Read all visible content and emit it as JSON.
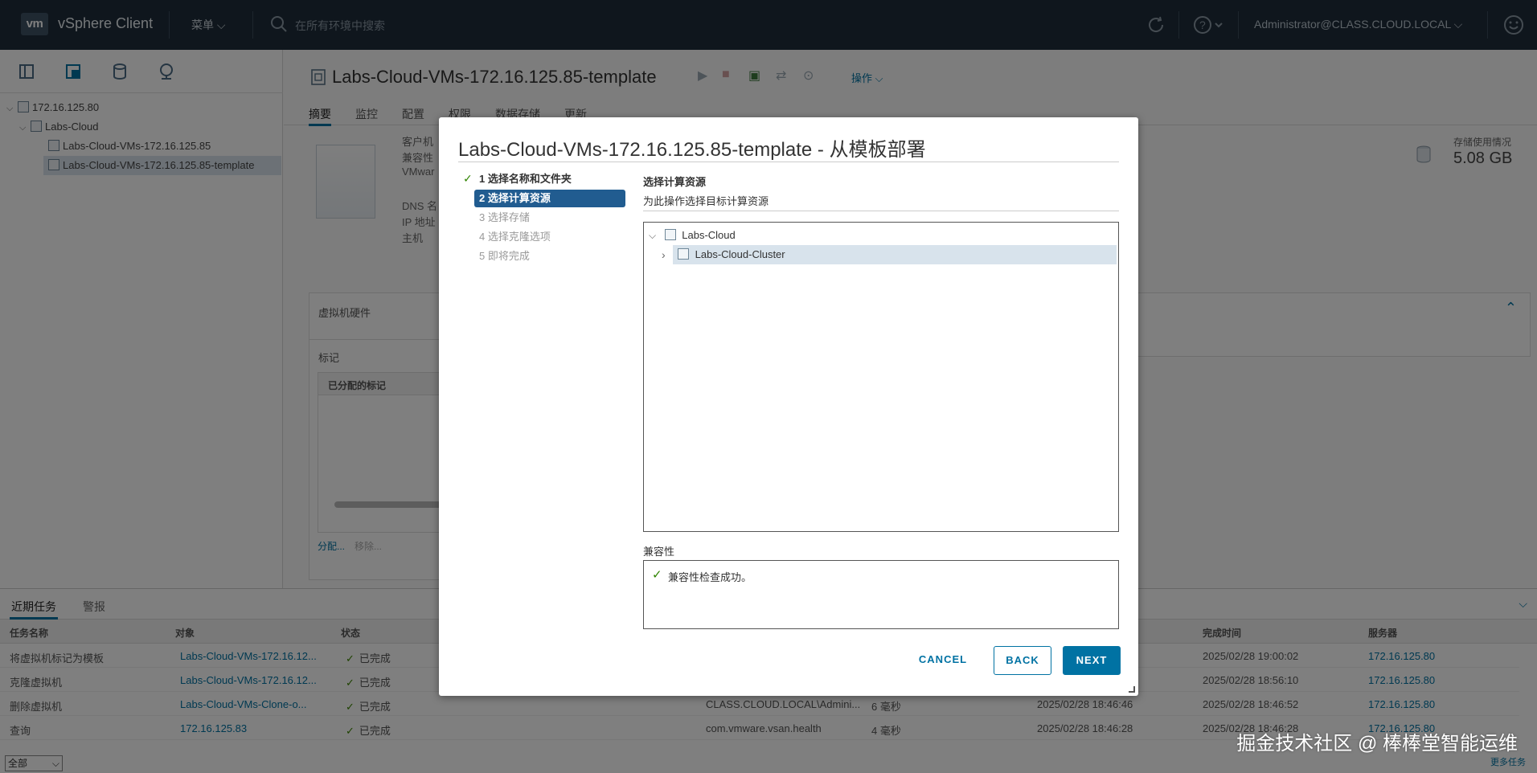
{
  "header": {
    "logo": "vm",
    "app_title": "vSphere Client",
    "menu_label": "菜单",
    "search_placeholder": "在所有环境中搜索",
    "user": "Administrator@CLASS.CLOUD.LOCAL"
  },
  "nav_tree": [
    {
      "label": "172.16.125.80"
    },
    {
      "label": "Labs-Cloud"
    },
    {
      "label": "Labs-Cloud-VMs-172.16.125.85"
    },
    {
      "label": "Labs-Cloud-VMs-172.16.125.85-template"
    }
  ],
  "main": {
    "title": "Labs-Cloud-VMs-172.16.125.85-template",
    "actions_label": "操作",
    "tabs": [
      {
        "label": "摘要"
      },
      {
        "label": "监控"
      },
      {
        "label": "配置"
      },
      {
        "label": "权限"
      },
      {
        "label": "数据存储"
      },
      {
        "label": "更新"
      }
    ],
    "summary_labels": [
      "客户机",
      "兼容性",
      "VMwar",
      "DNS 名",
      "IP 地址",
      "主机"
    ],
    "storage_label": "存储使用情况",
    "storage_value": "5.08 GB",
    "hw_card_title": "虚拟机硬件",
    "tags_card_title": "标记",
    "tags_col": "已分配的标记",
    "assign_link": "分配...",
    "remove_link": "移除..."
  },
  "bottom": {
    "tabs": [
      {
        "label": "近期任务"
      },
      {
        "label": "警报"
      }
    ],
    "columns": [
      "任务名称",
      "对象",
      "状态",
      "完成时间",
      "服务器"
    ],
    "rows": [
      {
        "task": "将虚拟机标记为模板",
        "object": "Labs-Cloud-VMs-172.16.12...",
        "status": "已完成",
        "initiator": "",
        "queued": "",
        "start": "",
        "done": "2025/02/28 19:00:02",
        "server": "172.16.125.80"
      },
      {
        "task": "克隆虚拟机",
        "object": "Labs-Cloud-VMs-172.16.12...",
        "status": "已完成",
        "initiator": "",
        "queued": "",
        "start": "",
        "done": "2025/02/28 18:56:10",
        "server": "172.16.125.80"
      },
      {
        "task": "删除虚拟机",
        "object": "Labs-Cloud-VMs-Clone-o...",
        "status": "已完成",
        "initiator": "CLASS.CLOUD.LOCAL\\Admini...",
        "queued": "6 毫秒",
        "start": "2025/02/28 18:46:46",
        "done": "2025/02/28 18:46:52",
        "server": "172.16.125.80"
      },
      {
        "task": "查询",
        "object": "172.16.125.83",
        "status": "已完成",
        "initiator": "com.vmware.vsan.health",
        "queued": "4 毫秒",
        "start": "2025/02/28 18:46:28",
        "done": "2025/02/28 18:46:28",
        "server": "172.16.125.80"
      }
    ],
    "filter_value": "全部",
    "more_tasks": "更多任务"
  },
  "modal": {
    "title": "Labs-Cloud-VMs-172.16.125.85-template - 从模板部署",
    "steps": [
      {
        "label": "1 选择名称和文件夹",
        "state": "done"
      },
      {
        "label": "2 选择计算资源",
        "state": "current"
      },
      {
        "label": "3 选择存储",
        "state": "pending"
      },
      {
        "label": "4 选择克隆选项",
        "state": "pending"
      },
      {
        "label": "5 即将完成",
        "state": "pending"
      }
    ],
    "section_title": "选择计算资源",
    "section_subtitle": "为此操作选择目标计算资源",
    "tree": [
      {
        "label": "Labs-Cloud"
      },
      {
        "label": "Labs-Cloud-Cluster"
      }
    ],
    "compat_label": "兼容性",
    "compat_message": "兼容性检查成功。",
    "cancel_label": "CANCEL",
    "back_label": "BACK",
    "next_label": "NEXT"
  },
  "watermark": "掘金技术社区 @ 棒棒堂智能运维",
  "colors": {
    "header_bg": "#1f2d3a",
    "accent": "#0072a3",
    "step_active": "#215c90",
    "success": "#2f8400"
  }
}
